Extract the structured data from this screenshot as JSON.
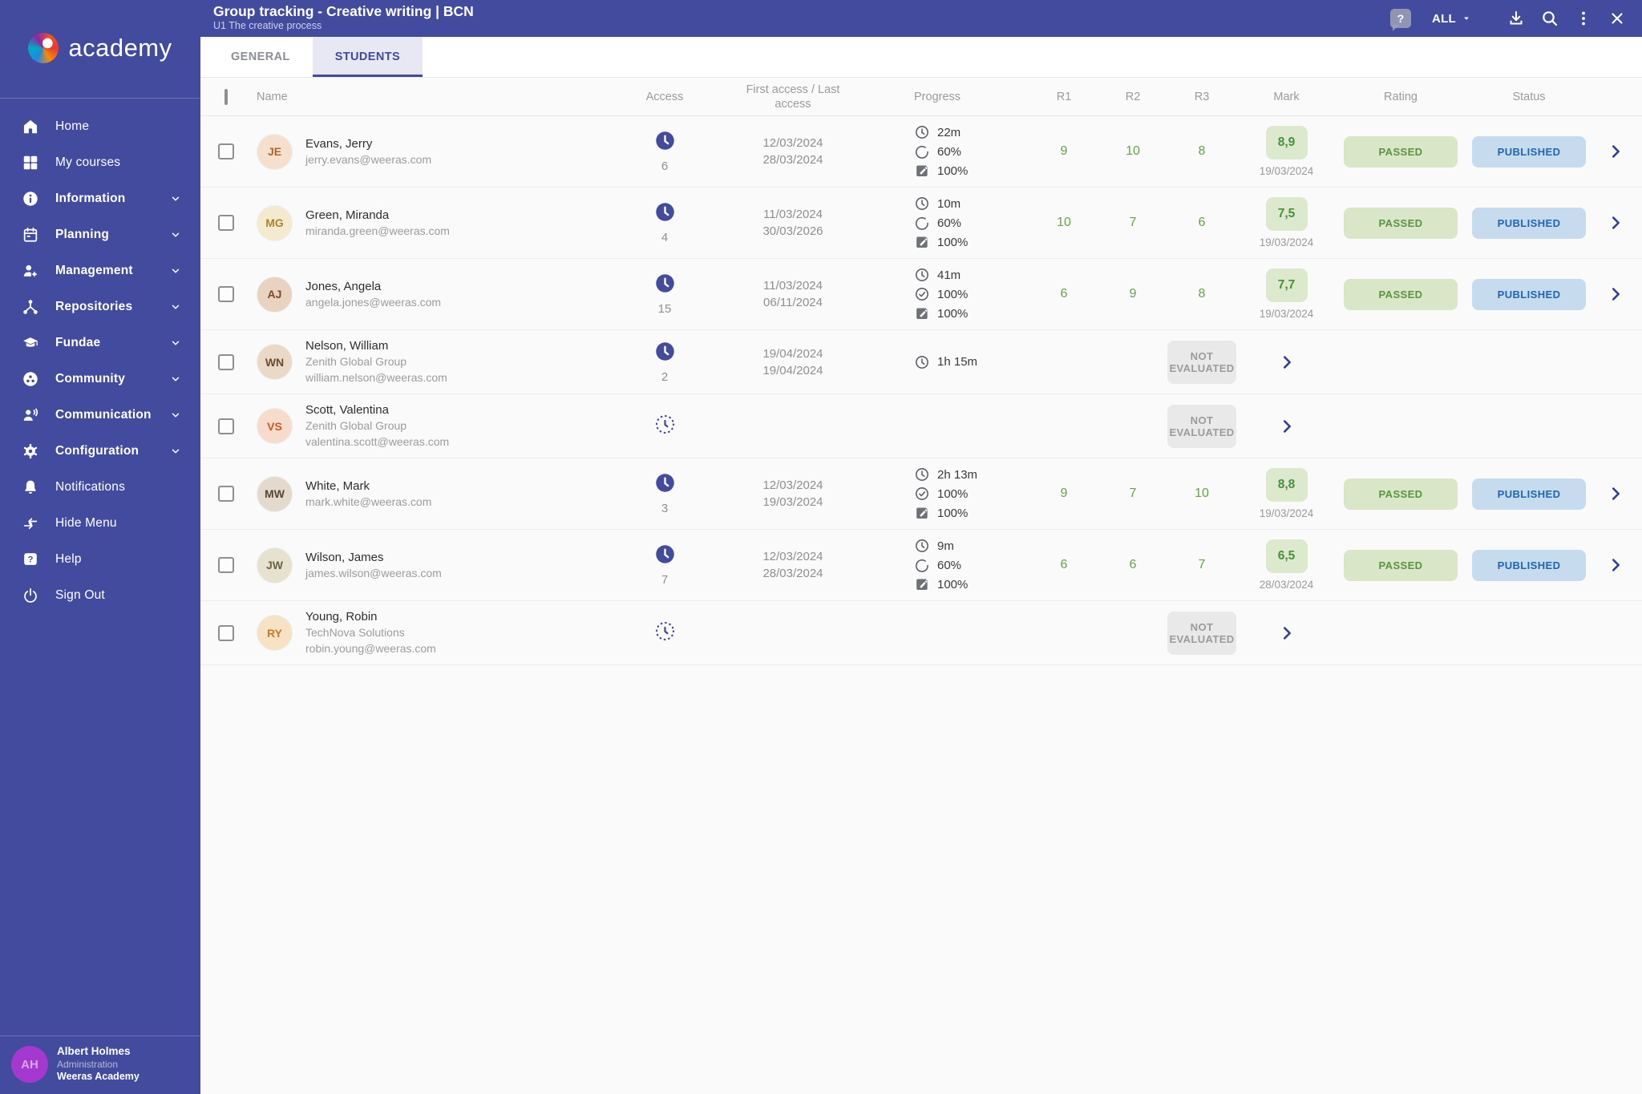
{
  "app": {
    "logo_text": "academy"
  },
  "header": {
    "title": "Group tracking - Creative writing | BCN",
    "subtitle": "U1 The creative process",
    "help_label": "?",
    "filter_label": "ALL"
  },
  "tabs": [
    {
      "label": "GENERAL",
      "active": false
    },
    {
      "label": "STUDENTS",
      "active": true
    }
  ],
  "sidebar": {
    "items": [
      {
        "label": "Home",
        "icon": "home",
        "expandable": false
      },
      {
        "label": "My courses",
        "icon": "courses",
        "expandable": false
      },
      {
        "label": "Information",
        "icon": "info",
        "expandable": true
      },
      {
        "label": "Planning",
        "icon": "calendar",
        "expandable": true
      },
      {
        "label": "Management",
        "icon": "user-gear",
        "expandable": true
      },
      {
        "label": "Repositories",
        "icon": "share",
        "expandable": true
      },
      {
        "label": "Fundae",
        "icon": "grad-cap",
        "expandable": true
      },
      {
        "label": "Community",
        "icon": "community",
        "expandable": true
      },
      {
        "label": "Communication",
        "icon": "person-talk",
        "expandable": true
      },
      {
        "label": "Configuration",
        "icon": "gear",
        "expandable": true
      },
      {
        "label": "Notifications",
        "icon": "bell",
        "expandable": false
      },
      {
        "label": "Hide Menu",
        "icon": "arrows-left",
        "expandable": false
      },
      {
        "label": "Help",
        "icon": "help",
        "expandable": false
      },
      {
        "label": "Sign Out",
        "icon": "power",
        "expandable": false
      }
    ]
  },
  "user": {
    "initials": "AH",
    "name": "Albert Holmes",
    "role": "Administration",
    "org": "Weeras Academy"
  },
  "table": {
    "columns": [
      "Name",
      "Access",
      "First access / Last access",
      "Progress",
      "R1",
      "R2",
      "R3",
      "Mark",
      "Rating",
      "Status"
    ]
  },
  "students": [
    {
      "name": "Evans, Jerry",
      "company": null,
      "email": "jerry.evans@weeras.com",
      "avatar": {
        "initials": "JE",
        "bg": "#f6e0cd",
        "fg": "#a9682f"
      },
      "access_count": "6",
      "first_access": "12/03/2024",
      "last_access": "28/03/2024",
      "progress": [
        {
          "icon": "clock",
          "text": "22m"
        },
        {
          "icon": "arc",
          "text": "60%"
        },
        {
          "icon": "edit",
          "text": "100%"
        }
      ],
      "r1": "9",
      "r2": "10",
      "r3": "8",
      "mark": "8,9",
      "mark_date": "19/03/2024",
      "rating": "PASSED",
      "status": "PUBLISHED",
      "status_type": "published"
    },
    {
      "name": "Green, Miranda",
      "company": null,
      "email": "miranda.green@weeras.com",
      "avatar": {
        "initials": "MG",
        "bg": "#f3ead0",
        "fg": "#a8852f"
      },
      "access_count": "4",
      "first_access": "11/03/2024",
      "last_access": "30/03/2026",
      "progress": [
        {
          "icon": "clock",
          "text": "10m"
        },
        {
          "icon": "arc",
          "text": "60%"
        },
        {
          "icon": "edit",
          "text": "100%"
        }
      ],
      "r1": "10",
      "r2": "7",
      "r3": "6",
      "mark": "7,5",
      "mark_date": "19/03/2024",
      "rating": "PASSED",
      "status": "PUBLISHED",
      "status_type": "published"
    },
    {
      "name": "Jones, Angela",
      "company": null,
      "email": "angela.jones@weeras.com",
      "avatar": {
        "initials": "AJ",
        "bg": "#e9d2c0",
        "fg": "#7a4a2b"
      },
      "access_count": "15",
      "first_access": "11/03/2024",
      "last_access": "06/11/2024",
      "progress": [
        {
          "icon": "clock",
          "text": "41m"
        },
        {
          "icon": "check",
          "text": "100%"
        },
        {
          "icon": "edit",
          "text": "100%"
        }
      ],
      "r1": "6",
      "r2": "9",
      "r3": "8",
      "mark": "7,7",
      "mark_date": "19/03/2024",
      "rating": "PASSED",
      "status": "PUBLISHED",
      "status_type": "published"
    },
    {
      "name": "Nelson, William",
      "company": "Zenith Global Group",
      "email": "william.nelson@weeras.com",
      "avatar": {
        "initials": "WN",
        "bg": "#ead9c6",
        "fg": "#6b4a2f"
      },
      "access_count": "2",
      "first_access": "19/04/2024",
      "last_access": "19/04/2024",
      "progress": [
        {
          "icon": "clock",
          "text": "1h 15m"
        }
      ],
      "r1": null,
      "r2": null,
      "r3": null,
      "mark": null,
      "mark_date": null,
      "rating": null,
      "status": "NOT EVALUATED",
      "status_type": "not-evaluated"
    },
    {
      "name": "Scott, Valentina",
      "company": "Zenith Global Group",
      "email": "valentina.scott@weeras.com",
      "avatar": {
        "initials": "VS",
        "bg": "#f7dccd",
        "fg": "#c05a2a"
      },
      "access_count": null,
      "first_access": null,
      "last_access": null,
      "progress": [],
      "r1": null,
      "r2": null,
      "r3": null,
      "mark": null,
      "mark_date": null,
      "rating": null,
      "status": "NOT EVALUATED",
      "status_type": "not-evaluated"
    },
    {
      "name": "White, Mark",
      "company": null,
      "email": "mark.white@weeras.com",
      "avatar": {
        "initials": "MW",
        "bg": "#e4d9cd",
        "fg": "#5a4636"
      },
      "access_count": "3",
      "first_access": "12/03/2024",
      "last_access": "19/03/2024",
      "progress": [
        {
          "icon": "clock",
          "text": "2h 13m"
        },
        {
          "icon": "check",
          "text": "100%"
        },
        {
          "icon": "edit",
          "text": "100%"
        }
      ],
      "r1": "9",
      "r2": "7",
      "r3": "10",
      "mark": "8,8",
      "mark_date": "19/03/2024",
      "rating": "PASSED",
      "status": "PUBLISHED",
      "status_type": "published"
    },
    {
      "name": "Wilson, James",
      "company": null,
      "email": "james.wilson@weeras.com",
      "avatar": {
        "initials": "JW",
        "bg": "#e7e2d0",
        "fg": "#6b6242"
      },
      "access_count": "7",
      "first_access": "12/03/2024",
      "last_access": "28/03/2024",
      "progress": [
        {
          "icon": "clock",
          "text": "9m"
        },
        {
          "icon": "arc",
          "text": "60%"
        },
        {
          "icon": "edit",
          "text": "100%"
        }
      ],
      "r1": "6",
      "r2": "6",
      "r3": "7",
      "mark": "6,5",
      "mark_date": "28/03/2024",
      "rating": "PASSED",
      "status": "PUBLISHED",
      "status_type": "published"
    },
    {
      "name": "Young, Robin",
      "company": "TechNova Solutions",
      "email": "robin.young@weeras.com",
      "avatar": {
        "initials": "RY",
        "bg": "#f7e2c6",
        "fg": "#c77b2e"
      },
      "access_count": null,
      "first_access": null,
      "last_access": null,
      "progress": [],
      "r1": null,
      "r2": null,
      "r3": null,
      "mark": null,
      "mark_date": null,
      "rating": null,
      "status": "NOT EVALUATED",
      "status_type": "not-evaluated"
    }
  ]
}
